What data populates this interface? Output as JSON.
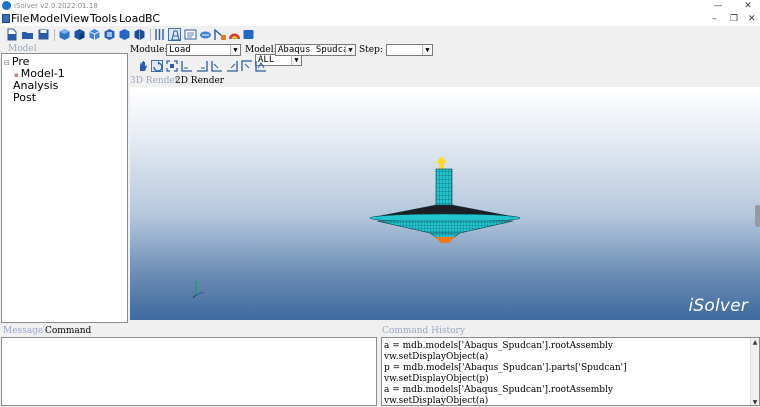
{
  "window": {
    "title": "iSolver v2.0.2022.01.18",
    "minimize": "—",
    "close": "✕"
  },
  "menubar": {
    "items": [
      "File",
      "Model",
      "View",
      "Tools",
      "Load",
      "BC"
    ],
    "minimize": "–",
    "restore": "❐",
    "close": "✕"
  },
  "toolbar": {
    "filter": {
      "value": "ALL"
    }
  },
  "module_bar": {
    "module_label": "Module:",
    "module_value": "Load",
    "model_label": "Model:",
    "model_value": "Abaqus Spudcan",
    "step_label": "Step:",
    "step_value": ""
  },
  "model_tree": {
    "caption": "Model",
    "items": [
      {
        "label": "Pre",
        "expand": "⊟"
      },
      {
        "label": "Model-1",
        "bullet": "▪"
      },
      {
        "label": "Analysis"
      },
      {
        "label": "Post"
      }
    ]
  },
  "viewport": {
    "tabs": [
      "3D Render",
      "2D Render"
    ],
    "logo": "iSolver",
    "colors": {
      "spudcan": "#21c4cf",
      "mesh": "#0a3d44",
      "load_arrow": "#ffd91a",
      "tip": "#f07a1a"
    }
  },
  "messages": {
    "tabs": [
      "Message",
      "Command"
    ]
  },
  "command_history": {
    "caption": "Command History",
    "lines": [
      "a = mdb.models['Abaqus_Spudcan'].rootAssembly",
      "vw.setDisplayObject(a)",
      "p = mdb.models['Abaqus_Spudcan'].parts['Spudcan']",
      "vw.setDisplayObject(p)",
      "a = mdb.models['Abaqus_Spudcan'].rootAssembly",
      "vw.setDisplayObject(a)"
    ],
    "scroll_up": "▲",
    "scroll_down": "▼"
  }
}
